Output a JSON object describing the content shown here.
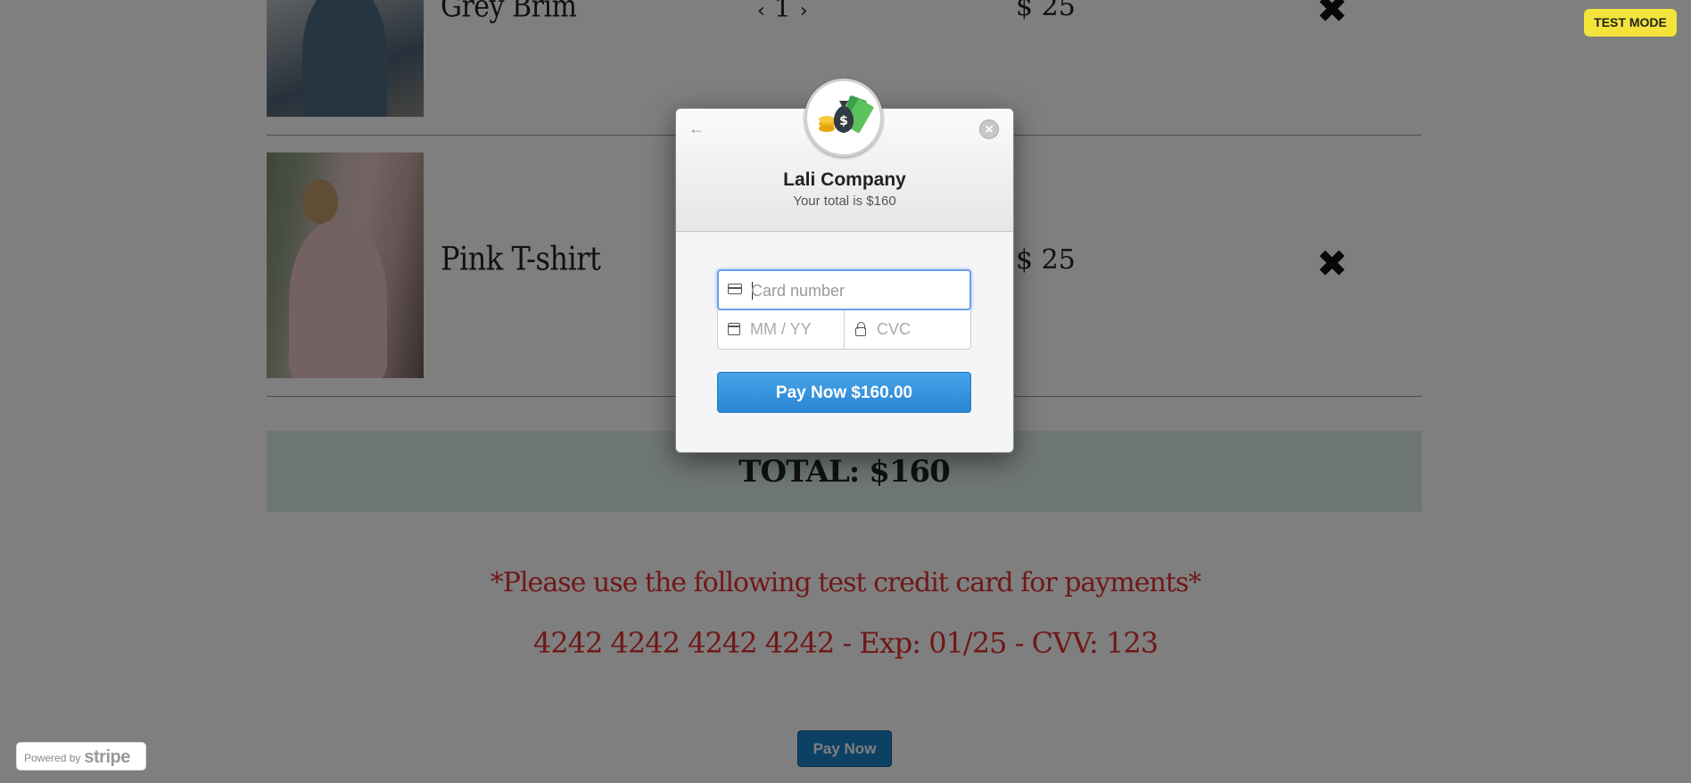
{
  "cart": {
    "items": [
      {
        "name": "Grey Brim",
        "qty": "1",
        "qty_dec": "‹",
        "qty_inc": "›",
        "price": "$ 25",
        "remove": "✖"
      },
      {
        "name": "Pink T-shirt",
        "price": "$ 25",
        "remove": "✖"
      }
    ],
    "total": "TOTAL: $160"
  },
  "notes": {
    "line1": "*Please use the following test credit card for payments*",
    "line2": "4242 4242 4242 4242 - Exp: 01/25 - CVV: 123"
  },
  "pay_now_label": "Pay Now",
  "powered_by": {
    "prefix": "Powered by",
    "brand": "stripe"
  },
  "test_mode": "TEST MODE",
  "modal": {
    "back_icon": "←",
    "close_icon": "×",
    "company": "Lali Company",
    "subtitle": "Your total is $160",
    "card_placeholder": "Card number",
    "expiry_placeholder": "MM / YY",
    "cvc_placeholder": "CVC",
    "pay_button": "Pay Now $160.00"
  },
  "colors": {
    "note_red": "#e03030",
    "pay_blue": "#2b86d3",
    "test_mode_yellow": "#f3e33a",
    "total_bar": "#dfecec"
  }
}
